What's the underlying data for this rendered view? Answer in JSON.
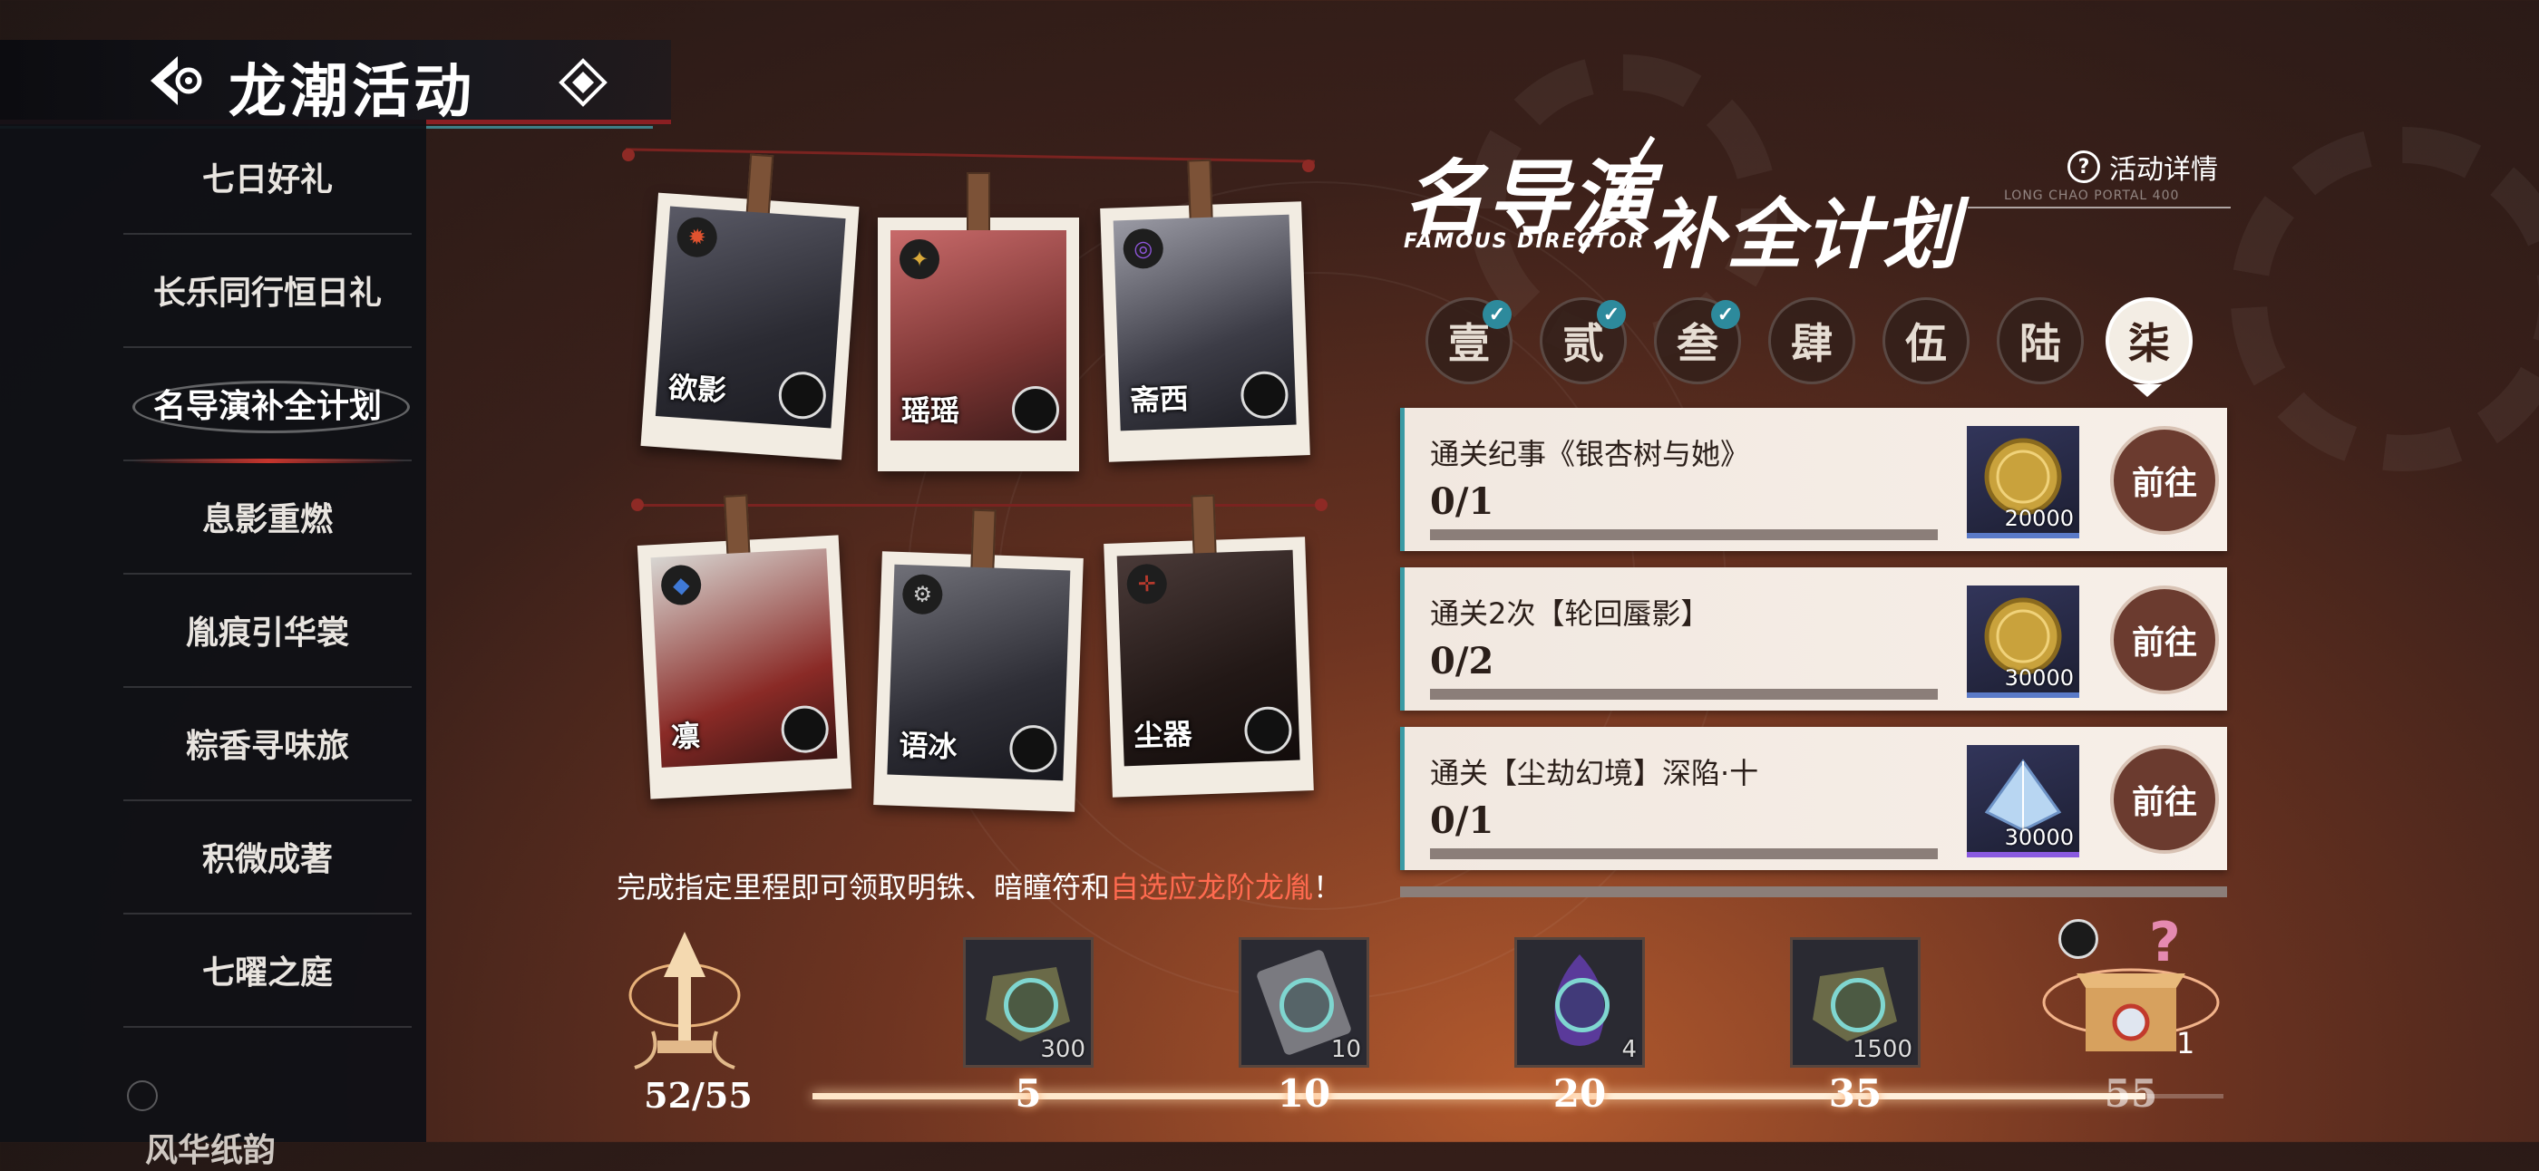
{
  "header": {
    "title": "龙潮活动",
    "back_icon": "back-arrow-icon",
    "home_icon": "diamond-home-icon"
  },
  "sidebar": {
    "items": [
      {
        "label": "七日好礼"
      },
      {
        "label": "长乐同行恒日礼"
      },
      {
        "label": "名导演补全计划",
        "active": true
      },
      {
        "label": "息影重燃"
      },
      {
        "label": "胤痕引华裳"
      },
      {
        "label": "粽香寻味旅"
      },
      {
        "label": "积微成著"
      },
      {
        "label": "七曜之庭"
      },
      {
        "label": "风华纸韵"
      }
    ]
  },
  "characters": [
    {
      "name": "欲影",
      "element_color": "#e0522f"
    },
    {
      "name": "瑶瑶",
      "element_color": "#d9a93a"
    },
    {
      "name": "斋西",
      "element_color": "#8d55d9"
    },
    {
      "name": "凛",
      "element_color": "#3f79d6"
    },
    {
      "name": "语冰",
      "element_color": "#c9c9c9"
    },
    {
      "name": "尘器",
      "element_color": "#b83a2d"
    }
  ],
  "event": {
    "title_part1": "名导演",
    "title_part2": "补全计划",
    "subtitle": "FAMOUS DIRECTOR",
    "tiny_text": "LONG CHAO PORTAL 400",
    "details_label": "活动详情"
  },
  "tabs": [
    {
      "label": "壹",
      "completed": true
    },
    {
      "label": "贰",
      "completed": true
    },
    {
      "label": "叁",
      "completed": true
    },
    {
      "label": "肆",
      "completed": false
    },
    {
      "label": "伍",
      "completed": false
    },
    {
      "label": "陆",
      "completed": false
    },
    {
      "label": "柒",
      "completed": false,
      "active": true
    }
  ],
  "tasks": [
    {
      "name": "通关纪事《银杏树与她》",
      "progress": "0/1",
      "reward_icon": "gold-coin-icon",
      "reward_amount": "20000",
      "button": "前往"
    },
    {
      "name": "通关2次【轮回蜃影】",
      "progress": "0/2",
      "reward_icon": "gold-coin-icon",
      "reward_amount": "30000",
      "button": "前往"
    },
    {
      "name": "通关【尘劫幻境】深陷·十",
      "progress": "0/1",
      "reward_icon": "crystal-icon",
      "reward_amount": "30000",
      "button": "前往"
    }
  ],
  "milestone": {
    "text_prefix": "完成指定里程即可领取明铢、暗瞳符和",
    "text_highlight": "自选应龙阶龙胤",
    "text_suffix": "！",
    "current": "52/55",
    "progress_fraction": 0.945,
    "rewards": [
      {
        "threshold": "5",
        "amount": "300",
        "claimed": true
      },
      {
        "threshold": "10",
        "amount": "10",
        "claimed": true
      },
      {
        "threshold": "20",
        "amount": "4",
        "claimed": true
      },
      {
        "threshold": "35",
        "amount": "1500",
        "claimed": true
      },
      {
        "threshold": "55",
        "amount": "1",
        "claimed": false
      }
    ]
  },
  "colors": {
    "accent_teal": "#3a9aa4",
    "highlight_red": "#ff6a4f",
    "header_red": "#8a1f22"
  }
}
